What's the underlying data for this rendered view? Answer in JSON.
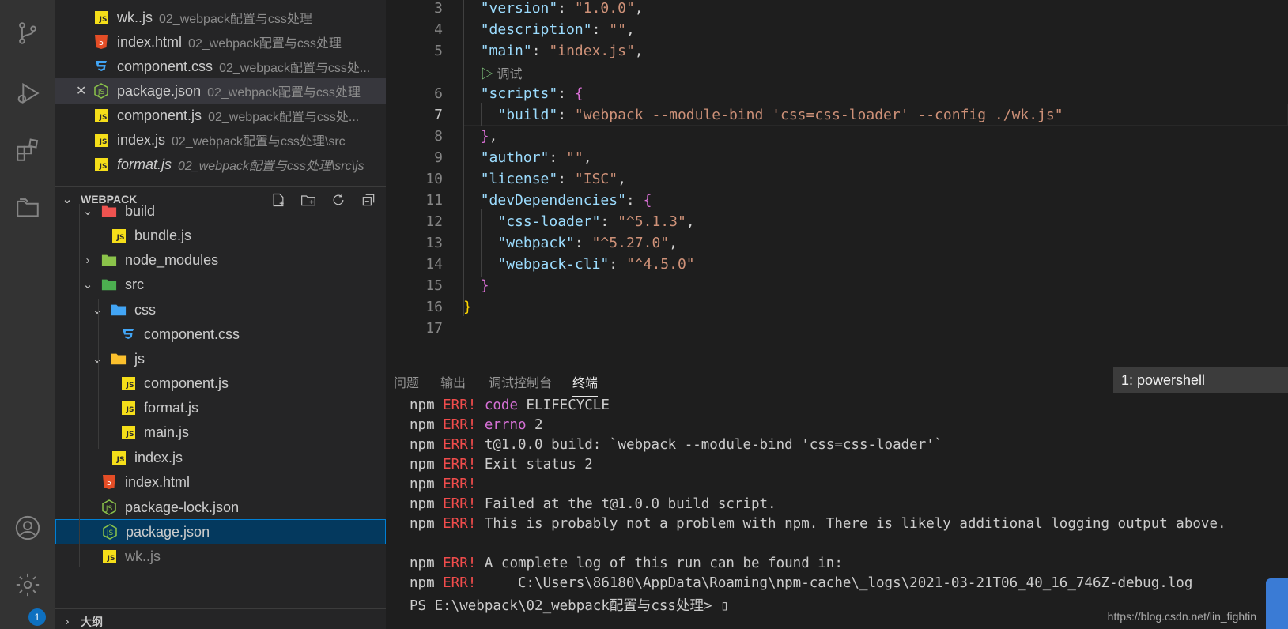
{
  "activity_bar": {
    "icons": [
      "source-control-icon",
      "run-debug-icon",
      "extensions-icon",
      "explorer-icon",
      "account-icon",
      "settings-icon"
    ],
    "settings_badge": "1"
  },
  "open_editors": [
    {
      "name": "wk..js",
      "desc": "02_webpack配置与css处理",
      "icon": "js",
      "italic": false,
      "close": false
    },
    {
      "name": "index.html",
      "desc": "02_webpack配置与css处理",
      "icon": "html",
      "italic": false,
      "close": false
    },
    {
      "name": "component.css",
      "desc": "02_webpack配置与css处...",
      "icon": "css",
      "italic": false,
      "close": false
    },
    {
      "name": "package.json",
      "desc": "02_webpack配置与css处理",
      "icon": "json",
      "italic": false,
      "close": true
    },
    {
      "name": "component.js",
      "desc": "02_webpack配置与css处...",
      "icon": "js",
      "italic": false,
      "close": false
    },
    {
      "name": "index.js",
      "desc": "02_webpack配置与css处理\\src",
      "icon": "js",
      "italic": false,
      "close": false
    },
    {
      "name": "format.js",
      "desc": "02_webpack配置与css处理\\src\\js",
      "icon": "js",
      "italic": true,
      "close": false
    }
  ],
  "workspace": {
    "title": "WEBPACK",
    "tree": [
      {
        "name": "build",
        "icon": "folder-build",
        "chevron": "open"
      },
      {
        "name": "bundle.js",
        "icon": "js",
        "chevron": ""
      },
      {
        "name": "node_modules",
        "icon": "folder-node",
        "chevron": "closed"
      },
      {
        "name": "src",
        "icon": "folder-src",
        "chevron": "open"
      },
      {
        "name": "css",
        "icon": "folder-css",
        "chevron": "open"
      },
      {
        "name": "component.css",
        "icon": "css",
        "chevron": ""
      },
      {
        "name": "js",
        "icon": "folder-js",
        "chevron": "open"
      },
      {
        "name": "component.js",
        "icon": "js",
        "chevron": ""
      },
      {
        "name": "format.js",
        "icon": "js",
        "chevron": ""
      },
      {
        "name": "main.js",
        "icon": "js",
        "chevron": ""
      },
      {
        "name": "index.js",
        "icon": "js",
        "chevron": ""
      },
      {
        "name": "index.html",
        "icon": "html",
        "chevron": ""
      },
      {
        "name": "package-lock.json",
        "icon": "json",
        "chevron": ""
      },
      {
        "name": "package.json",
        "icon": "json",
        "chevron": ""
      },
      {
        "name": "wk..js",
        "icon": "js",
        "chevron": ""
      }
    ],
    "next_section": "大纲"
  },
  "editor": {
    "codelens": "调试",
    "lines": [
      {
        "num": "3"
      },
      {
        "num": "4"
      },
      {
        "num": "5"
      },
      {
        "num": "6"
      },
      {
        "num": "7"
      },
      {
        "num": "8"
      },
      {
        "num": "9"
      },
      {
        "num": "10"
      },
      {
        "num": "11"
      },
      {
        "num": "12"
      },
      {
        "num": "13"
      },
      {
        "num": "14"
      },
      {
        "num": "15"
      },
      {
        "num": "16"
      },
      {
        "num": "17"
      }
    ],
    "tokens": {
      "l3k": "\"version\"",
      "l3v": "\"1.0.0\"",
      "l4k": "\"description\"",
      "l4v": "\"\"",
      "l5k": "\"main\"",
      "l5v": "\"index.js\"",
      "l6k": "\"scripts\"",
      "l7k": "\"build\"",
      "l7v": "\"webpack --module-bind 'css=css-loader' --config ./wk.js\"",
      "l9k": "\"author\"",
      "l9v": "\"\"",
      "l10k": "\"license\"",
      "l10v": "\"ISC\"",
      "l11k": "\"devDependencies\"",
      "l12k": "\"css-loader\"",
      "l12v": "\"^5.1.3\"",
      "l13k": "\"webpack\"",
      "l13v": "\"^5.27.0\"",
      "l14k": "\"webpack-cli\"",
      "l14v": "\"^4.5.0\""
    }
  },
  "panel": {
    "tabs": [
      "问题",
      "输出",
      "调试控制台",
      "终端"
    ],
    "active_tab": "终端",
    "terminal_select": "1: powershell",
    "lines": [
      {
        "a": "npm",
        "b": "ERR!",
        "c": "code",
        "d": " ELIFECYCLE"
      },
      {
        "a": "npm",
        "b": "ERR!",
        "c": "errno",
        "d": " 2"
      },
      {
        "a": "npm",
        "b": "ERR!",
        "c": "",
        "d": "t@1.0.0 build: `webpack --module-bind 'css=css-loader'`"
      },
      {
        "a": "npm",
        "b": "ERR!",
        "c": "",
        "d": "Exit status 2"
      },
      {
        "a": "npm",
        "b": "ERR!",
        "c": "",
        "d": ""
      },
      {
        "a": "npm",
        "b": "ERR!",
        "c": "",
        "d": "Failed at the t@1.0.0 build script."
      },
      {
        "a": "npm",
        "b": "ERR!",
        "c": "",
        "d": "This is probably not a problem with npm. There is likely additional logging output above."
      },
      {
        "a": "",
        "b": "",
        "c": "",
        "d": ""
      },
      {
        "a": "npm",
        "b": "ERR!",
        "c": "",
        "d": "A complete log of this run can be found in:"
      },
      {
        "a": "npm",
        "b": "ERR!",
        "c": "",
        "d": "    C:\\Users\\86180\\AppData\\Roaming\\npm-cache\\_logs\\2021-03-21T06_40_16_746Z-debug.log"
      },
      {
        "a": "PS E:\\webpack\\02_webpack配置与css处理>",
        "b": "",
        "c": "",
        "d": " ▯"
      }
    ],
    "watermark": "https://blog.csdn.net/lin_fightin"
  },
  "colors": {
    "accent": "#0e70c0",
    "selection": "#04395e",
    "error": "#f14c4c"
  }
}
